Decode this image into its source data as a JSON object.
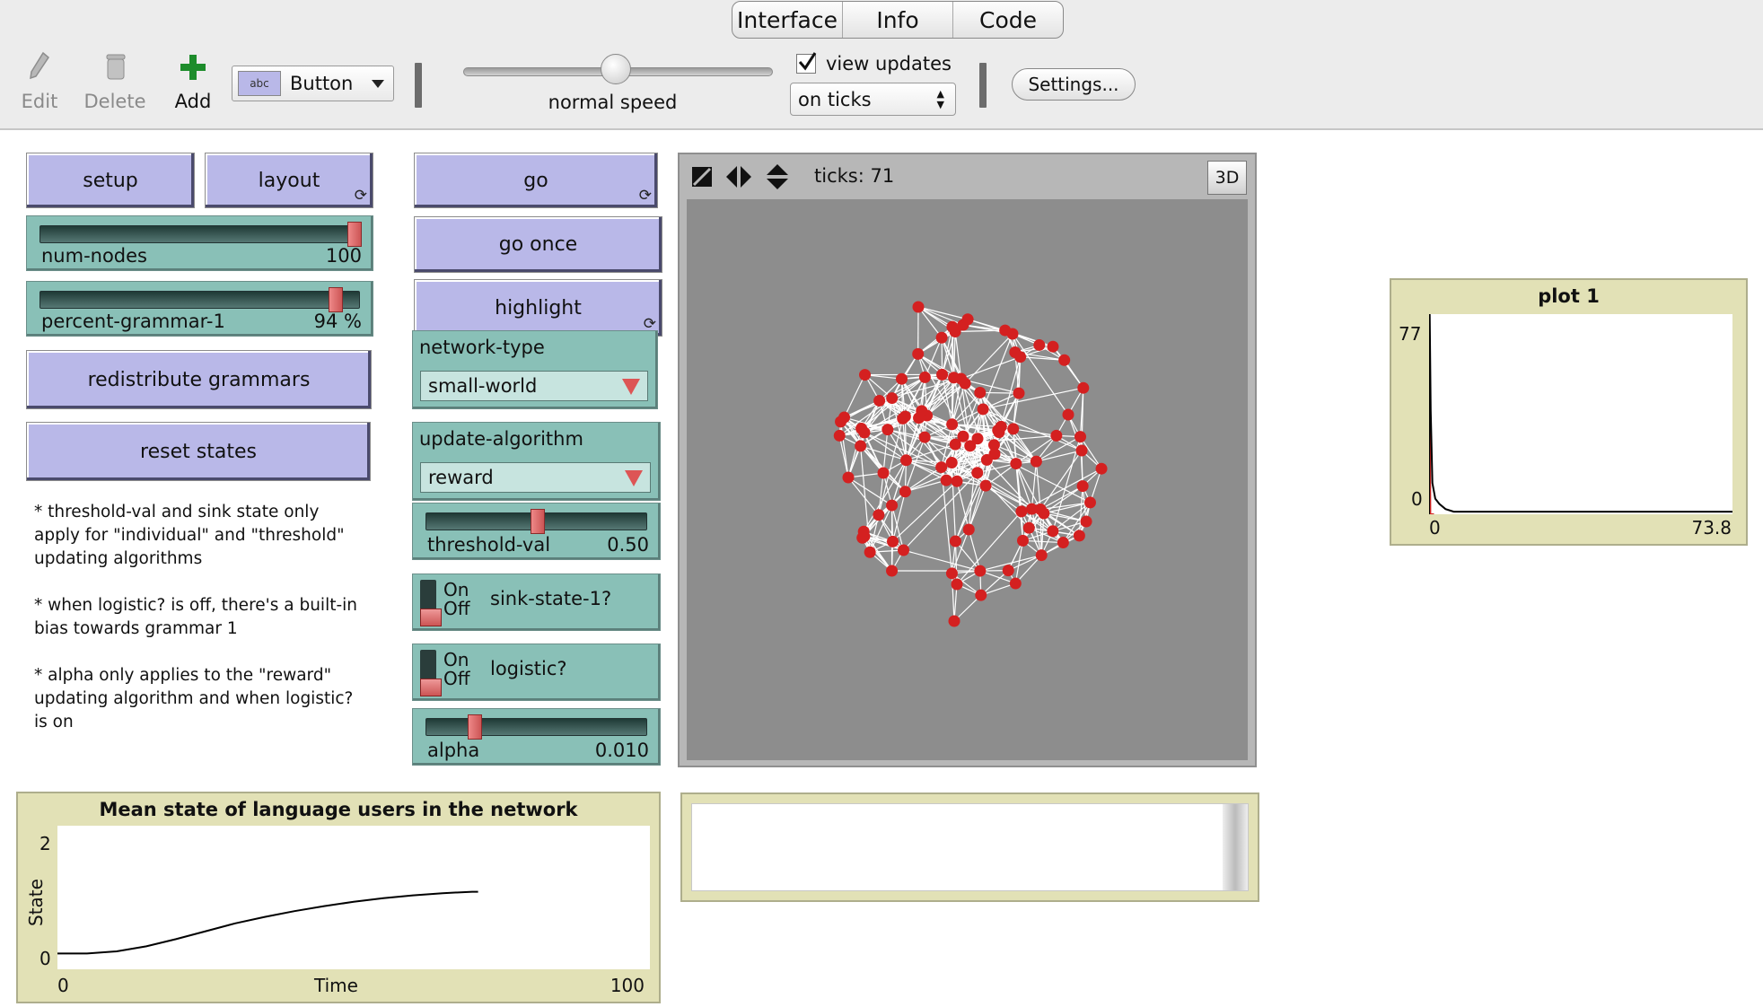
{
  "tabs": [
    "Interface",
    "Info",
    "Code"
  ],
  "toolbar": {
    "edit_label": "Edit",
    "delete_label": "Delete",
    "add_label": "Add",
    "widget_type": "Button",
    "speed_label": "normal speed",
    "view_updates_label": "view updates",
    "view_updates_checked": true,
    "update_mode": "on ticks",
    "settings_label": "Settings..."
  },
  "buttons": {
    "setup": "setup",
    "layout": "layout",
    "go": "go",
    "go_once": "go once",
    "highlight": "highlight",
    "redistribute": "redistribute grammars",
    "reset_states": "reset states"
  },
  "sliders": {
    "num_nodes": {
      "label": "num-nodes",
      "value": "100",
      "fraction": 1.0
    },
    "percent_grammar_1": {
      "label": "percent-grammar-1",
      "value": "94 %",
      "fraction": 0.94
    },
    "threshold_val": {
      "label": "threshold-val",
      "value": "0.50",
      "fraction": 0.5
    },
    "alpha": {
      "label": "alpha",
      "value": "0.010",
      "fraction": 0.2
    }
  },
  "choosers": {
    "network_type": {
      "label": "network-type",
      "value": "small-world"
    },
    "update_algorithm": {
      "label": "update-algorithm",
      "value": "reward"
    }
  },
  "switches": {
    "sink_state_1": {
      "label": "sink-state-1?",
      "on": "On",
      "off": "Off",
      "state": "off"
    },
    "logistic": {
      "label": "logistic?",
      "on": "On",
      "off": "Off",
      "state": "off"
    }
  },
  "notes": [
    "* threshold-val and sink state only apply for \"individual\" and \"threshold\" updating algorithms",
    "* when logistic? is off, there's a built-in bias towards grammar 1",
    "* alpha only applies to the \"reward\" updating algorithm and when logistic? is on"
  ],
  "view": {
    "ticks_text": "ticks: 71",
    "btn_3d": "3D",
    "node_color": "#d42020",
    "link_color": "#ffffff",
    "background_color": "#8d8d8d"
  },
  "colors": {
    "button": "#b9b8e8",
    "slider": "#89c0b7",
    "plot": "#e2e1b6"
  },
  "plot1": {
    "title": "plot 1",
    "y_max_label": "77",
    "y_min_label": "0",
    "x_min_label": "0",
    "x_max_label": "73.8"
  },
  "mean_plot": {
    "title": "Mean state of language users in the network",
    "ylabel": "State",
    "xlabel": "Time",
    "y_max_label": "2",
    "y_min_label": "0",
    "x_min_label": "0",
    "x_max_label": "100"
  },
  "chart_data": [
    {
      "type": "line",
      "title": "Mean state of language users in the network",
      "xlabel": "Time",
      "ylabel": "State",
      "xlim": [
        0,
        100
      ],
      "ylim": [
        0,
        2
      ],
      "series": [
        {
          "x": [
            0,
            5,
            10,
            15,
            20,
            25,
            30,
            35,
            40,
            45,
            50,
            55,
            60,
            65,
            70,
            71
          ],
          "y": [
            0.22,
            0.22,
            0.25,
            0.32,
            0.42,
            0.53,
            0.64,
            0.73,
            0.81,
            0.88,
            0.94,
            0.99,
            1.03,
            1.06,
            1.08,
            1.08
          ]
        }
      ]
    },
    {
      "type": "line",
      "title": "plot 1",
      "xlim": [
        0,
        73.8
      ],
      "ylim": [
        0,
        77
      ],
      "series": [
        {
          "color": "#d42020",
          "x": [
            0,
            0.15,
            0.3,
            0.5,
            0.8,
            1.2
          ],
          "y": [
            0,
            50,
            0,
            0,
            0,
            0
          ]
        },
        {
          "color": "#000000",
          "x": [
            0,
            0.15,
            0.4,
            0.8,
            1.5,
            2.5,
            4,
            6,
            10,
            30,
            50,
            73.8
          ],
          "y": [
            0,
            77,
            40,
            12,
            6,
            4,
            2,
            1,
            1,
            1,
            1,
            1
          ]
        }
      ]
    }
  ]
}
